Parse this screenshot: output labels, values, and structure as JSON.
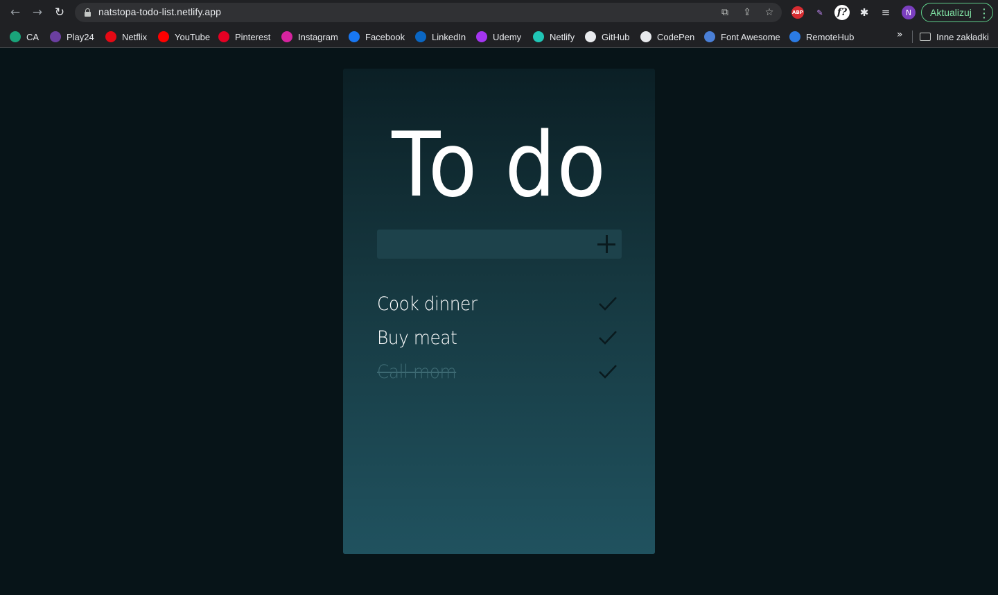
{
  "browser": {
    "url": "natstopa-todo-list.netlify.app",
    "update_label": "Aktualizuj",
    "avatar_letter": "N",
    "abp_label": "ABP",
    "fq_label": "f?",
    "bookmarks": [
      {
        "label": "CA",
        "icon": "ca-icon",
        "color": "#1aa37a"
      },
      {
        "label": "Play24",
        "icon": "play24-icon",
        "color": "#6b3fa0"
      },
      {
        "label": "Netflix",
        "icon": "netflix-icon",
        "color": "#e50914"
      },
      {
        "label": "YouTube",
        "icon": "youtube-icon",
        "color": "#ff0000"
      },
      {
        "label": "Pinterest",
        "icon": "pinterest-icon",
        "color": "#e60023"
      },
      {
        "label": "Instagram",
        "icon": "instagram-icon",
        "color": "#d6249f"
      },
      {
        "label": "Facebook",
        "icon": "facebook-icon",
        "color": "#1877f2"
      },
      {
        "label": "LinkedIn",
        "icon": "linkedin-icon",
        "color": "#0a66c2"
      },
      {
        "label": "Udemy",
        "icon": "udemy-icon",
        "color": "#a435f0"
      },
      {
        "label": "Netlify",
        "icon": "netlify-icon",
        "color": "#20c6b6"
      },
      {
        "label": "GitHub",
        "icon": "github-icon",
        "color": "#e8eaed"
      },
      {
        "label": "CodePen",
        "icon": "codepen-icon",
        "color": "#e8eaed"
      },
      {
        "label": "Font Awesome",
        "icon": "font-awesome-icon",
        "color": "#4a7fd6"
      },
      {
        "label": "RemoteHub",
        "icon": "remotehub-icon",
        "color": "#2b7be4"
      }
    ],
    "more_bookmarks": "»",
    "other_bookmarks": "Inne zakładki"
  },
  "app": {
    "title": "To do",
    "input_value": "",
    "todos": [
      {
        "text": "Cook dinner",
        "done": false
      },
      {
        "text": "Buy meat",
        "done": false
      },
      {
        "text": "Call mom",
        "done": true
      }
    ]
  }
}
